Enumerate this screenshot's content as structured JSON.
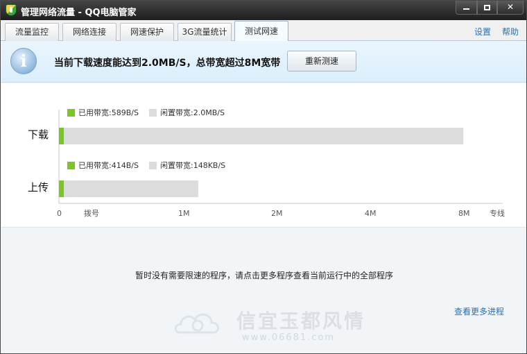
{
  "window": {
    "title": "管理网络流量 - QQ电脑管家"
  },
  "tabs": [
    {
      "label": "流量监控",
      "active": false
    },
    {
      "label": "网络连接",
      "active": false
    },
    {
      "label": "网速保护",
      "active": false
    },
    {
      "label": "3G流量统计",
      "active": false
    },
    {
      "label": "测试网速",
      "active": true
    }
  ],
  "top_links": {
    "settings": "设置",
    "help": "帮助"
  },
  "banner": {
    "message": "当前下载速度能达到2.0MB/S，总带宽超过8M宽带",
    "retest_label": "重新测速"
  },
  "colors": {
    "used": "#7ac627",
    "idle": "#dcdcdc",
    "link": "#2a6fb8"
  },
  "chart_data": {
    "type": "bar",
    "categories": [
      "下载",
      "上传"
    ],
    "series": [
      {
        "name": "已用带宽",
        "values": [
          0.0045,
          0.0032
        ]
      },
      {
        "name": "闲置带宽",
        "values": [
          8.0,
          1.16
        ]
      }
    ],
    "legends": [
      {
        "used_label": "已用带宽:589B/S",
        "idle_label": "闲置带宽:2.0MB/S"
      },
      {
        "used_label": "已用带宽:414B/S",
        "idle_label": "闲置带宽:148KB/S"
      }
    ],
    "x_ticks": [
      {
        "label": "0",
        "value": 0
      },
      {
        "label": "拨号",
        "value": 0.35
      },
      {
        "label": "1M",
        "value": 1
      },
      {
        "label": "2M",
        "value": 2
      },
      {
        "label": "4M",
        "value": 4
      },
      {
        "label": "8M",
        "value": 8
      },
      {
        "label": "专线",
        "value": 8.9
      }
    ],
    "xlim": [
      0,
      9.2
    ],
    "orientation": "horizontal"
  },
  "notice": "暂时没有需要限速的程序，请点击更多程序查看当前运行中的全部程序",
  "more_link": "查看更多进程",
  "watermark": {
    "text": "信宜玉都风情",
    "url": "www.06681.com"
  }
}
